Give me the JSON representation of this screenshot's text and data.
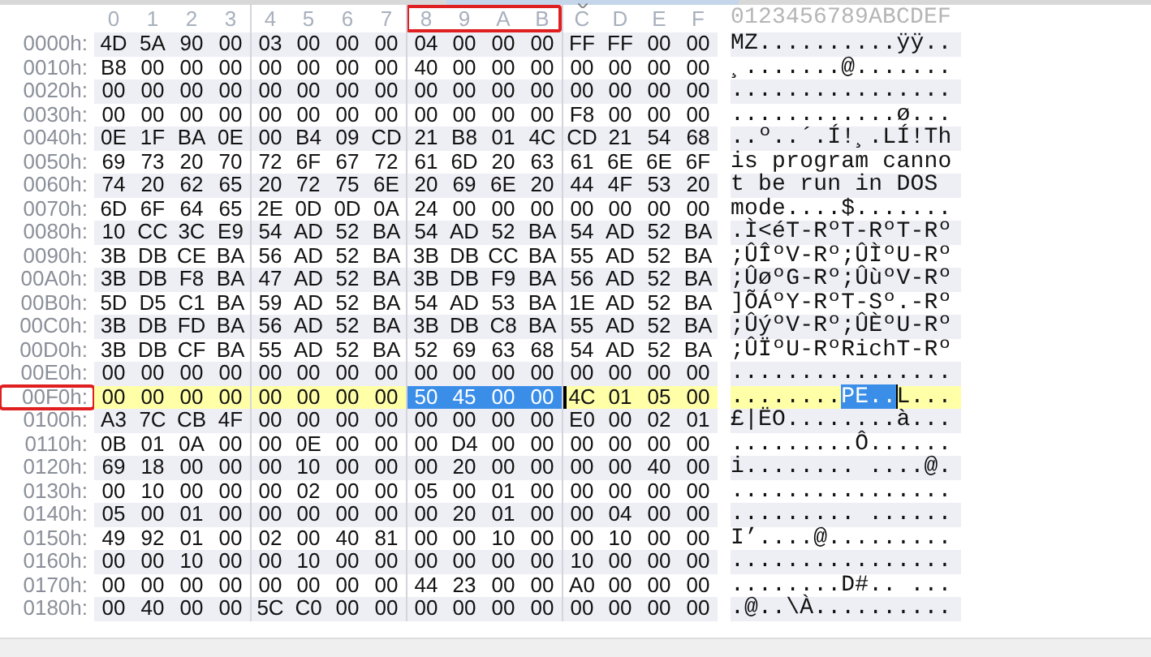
{
  "header": {
    "columns": [
      {
        "label": "0",
        "cursor": false,
        "marked": false
      },
      {
        "label": "1",
        "cursor": false,
        "marked": false
      },
      {
        "label": "2",
        "cursor": false,
        "marked": false
      },
      {
        "label": "3",
        "cursor": false,
        "marked": false
      },
      {
        "label": "4",
        "cursor": false,
        "marked": false
      },
      {
        "label": "5",
        "cursor": false,
        "marked": false
      },
      {
        "label": "6",
        "cursor": false,
        "marked": false
      },
      {
        "label": "7",
        "cursor": false,
        "marked": false
      },
      {
        "label": "8",
        "cursor": false,
        "marked": true
      },
      {
        "label": "9",
        "cursor": false,
        "marked": true
      },
      {
        "label": "A",
        "cursor": false,
        "marked": true
      },
      {
        "label": "B",
        "cursor": false,
        "marked": true
      },
      {
        "label": "C",
        "cursor": true,
        "marked": false
      },
      {
        "label": "D",
        "cursor": false,
        "marked": false
      },
      {
        "label": "E",
        "cursor": false,
        "marked": false
      },
      {
        "label": "F",
        "cursor": false,
        "marked": false
      }
    ],
    "text_header": "0123456789ABCDEF"
  },
  "rows": [
    {
      "offset": "0000h:",
      "bytes": "4D 5A 90 00 03 00 00 00 04 00 00 00 FF FF 00 00",
      "text": "MZ..........ÿÿ..",
      "current": false,
      "marked": false,
      "selected": [
        false,
        false,
        false,
        false,
        false,
        false,
        false,
        false,
        false,
        false,
        false,
        false,
        false,
        false,
        false,
        false
      ]
    },
    {
      "offset": "0010h:",
      "bytes": "B8 00 00 00 00 00 00 00 40 00 00 00 00 00 00 00",
      "text": "¸.......@.......",
      "current": false,
      "marked": false,
      "selected": [
        false,
        false,
        false,
        false,
        false,
        false,
        false,
        false,
        false,
        false,
        false,
        false,
        false,
        false,
        false,
        false
      ]
    },
    {
      "offset": "0020h:",
      "bytes": "00 00 00 00 00 00 00 00 00 00 00 00 00 00 00 00",
      "text": "................",
      "current": false,
      "marked": false,
      "selected": [
        false,
        false,
        false,
        false,
        false,
        false,
        false,
        false,
        false,
        false,
        false,
        false,
        false,
        false,
        false,
        false
      ]
    },
    {
      "offset": "0030h:",
      "bytes": "00 00 00 00 00 00 00 00 00 00 00 00 F8 00 00 00",
      "text": "............ø...",
      "current": false,
      "marked": false,
      "selected": [
        false,
        false,
        false,
        false,
        false,
        false,
        false,
        false,
        false,
        false,
        false,
        false,
        false,
        false,
        false,
        false
      ]
    },
    {
      "offset": "0040h:",
      "bytes": "0E 1F BA 0E 00 B4 09 CD 21 B8 01 4C CD 21 54 68",
      "text": "..º..´.Í!¸.LÍ!Th",
      "current": false,
      "marked": false,
      "selected": [
        false,
        false,
        false,
        false,
        false,
        false,
        false,
        false,
        false,
        false,
        false,
        false,
        false,
        false,
        false,
        false
      ]
    },
    {
      "offset": "0050h:",
      "bytes": "69 73 20 70 72 6F 67 72 61 6D 20 63 61 6E 6E 6F",
      "text": "is program canno",
      "current": false,
      "marked": false,
      "selected": [
        false,
        false,
        false,
        false,
        false,
        false,
        false,
        false,
        false,
        false,
        false,
        false,
        false,
        false,
        false,
        false
      ]
    },
    {
      "offset": "0060h:",
      "bytes": "74 20 62 65 20 72 75 6E 20 69 6E 20 44 4F 53 20",
      "text": "t be run in DOS ",
      "current": false,
      "marked": false,
      "selected": [
        false,
        false,
        false,
        false,
        false,
        false,
        false,
        false,
        false,
        false,
        false,
        false,
        false,
        false,
        false,
        false
      ]
    },
    {
      "offset": "0070h:",
      "bytes": "6D 6F 64 65 2E 0D 0D 0A 24 00 00 00 00 00 00 00",
      "text": "mode....$.......",
      "current": false,
      "marked": false,
      "selected": [
        false,
        false,
        false,
        false,
        false,
        false,
        false,
        false,
        false,
        false,
        false,
        false,
        false,
        false,
        false,
        false
      ]
    },
    {
      "offset": "0080h:",
      "bytes": "10 CC 3C E9 54 AD 52 BA 54 AD 52 BA 54 AD 52 BA",
      "text": ".Ì<éT-RºT-RºT-Rº",
      "current": false,
      "marked": false,
      "selected": [
        false,
        false,
        false,
        false,
        false,
        false,
        false,
        false,
        false,
        false,
        false,
        false,
        false,
        false,
        false,
        false
      ]
    },
    {
      "offset": "0090h:",
      "bytes": "3B DB CE BA 56 AD 52 BA 3B DB CC BA 55 AD 52 BA",
      "text": ";ÛÎºV-Rº;ÛÌºU-Rº",
      "current": false,
      "marked": false,
      "selected": [
        false,
        false,
        false,
        false,
        false,
        false,
        false,
        false,
        false,
        false,
        false,
        false,
        false,
        false,
        false,
        false
      ]
    },
    {
      "offset": "00A0h:",
      "bytes": "3B DB F8 BA 47 AD 52 BA 3B DB F9 BA 56 AD 52 BA",
      "text": ";ÛøºG-Rº;ÛùºV-Rº",
      "current": false,
      "marked": false,
      "selected": [
        false,
        false,
        false,
        false,
        false,
        false,
        false,
        false,
        false,
        false,
        false,
        false,
        false,
        false,
        false,
        false
      ]
    },
    {
      "offset": "00B0h:",
      "bytes": "5D D5 C1 BA 59 AD 52 BA 54 AD 53 BA 1E AD 52 BA",
      "text": "]ÕÁºY-RºT-Sº.-Rº",
      "current": false,
      "marked": false,
      "selected": [
        false,
        false,
        false,
        false,
        false,
        false,
        false,
        false,
        false,
        false,
        false,
        false,
        false,
        false,
        false,
        false
      ]
    },
    {
      "offset": "00C0h:",
      "bytes": "3B DB FD BA 56 AD 52 BA 3B DB C8 BA 55 AD 52 BA",
      "text": ";ÛýºV-Rº;ÛÈºU-Rº",
      "current": false,
      "marked": false,
      "selected": [
        false,
        false,
        false,
        false,
        false,
        false,
        false,
        false,
        false,
        false,
        false,
        false,
        false,
        false,
        false,
        false
      ]
    },
    {
      "offset": "00D0h:",
      "bytes": "3B DB CF BA 55 AD 52 BA 52 69 63 68 54 AD 52 BA",
      "text": ";ÛÏºU-RºRichT-Rº",
      "current": false,
      "marked": false,
      "selected": [
        false,
        false,
        false,
        false,
        false,
        false,
        false,
        false,
        false,
        false,
        false,
        false,
        false,
        false,
        false,
        false
      ]
    },
    {
      "offset": "00E0h:",
      "bytes": "00 00 00 00 00 00 00 00 00 00 00 00 00 00 00 00",
      "text": "................",
      "current": false,
      "marked": false,
      "selected": [
        false,
        false,
        false,
        false,
        false,
        false,
        false,
        false,
        false,
        false,
        false,
        false,
        false,
        false,
        false,
        false
      ]
    },
    {
      "offset": "00F0h:",
      "bytes": "00 00 00 00 00 00 00 00 50 45 00 00 4C 01 05 00",
      "text": "........PE..L...",
      "current": true,
      "marked": true,
      "selected": [
        false,
        false,
        false,
        false,
        false,
        false,
        false,
        false,
        true,
        true,
        true,
        true,
        false,
        false,
        false,
        false
      ]
    },
    {
      "offset": "0100h:",
      "bytes": "A3 7C CB 4F 00 00 00 00 00 00 00 00 E0 00 02 01",
      "text": "£|ËO........à...",
      "current": false,
      "marked": false,
      "selected": [
        false,
        false,
        false,
        false,
        false,
        false,
        false,
        false,
        false,
        false,
        false,
        false,
        false,
        false,
        false,
        false
      ]
    },
    {
      "offset": "0110h:",
      "bytes": "0B 01 0A 00 00 0E 00 00 00 D4 00 00 00 00 00 00",
      "text": ".........Ô......",
      "current": false,
      "marked": false,
      "selected": [
        false,
        false,
        false,
        false,
        false,
        false,
        false,
        false,
        false,
        false,
        false,
        false,
        false,
        false,
        false,
        false
      ]
    },
    {
      "offset": "0120h:",
      "bytes": "69 18 00 00 00 10 00 00 00 20 00 00 00 00 40 00",
      "text": "i........ ....@.",
      "current": false,
      "marked": false,
      "selected": [
        false,
        false,
        false,
        false,
        false,
        false,
        false,
        false,
        false,
        false,
        false,
        false,
        false,
        false,
        false,
        false
      ]
    },
    {
      "offset": "0130h:",
      "bytes": "00 10 00 00 00 02 00 00 05 00 01 00 00 00 00 00",
      "text": "................",
      "current": false,
      "marked": false,
      "selected": [
        false,
        false,
        false,
        false,
        false,
        false,
        false,
        false,
        false,
        false,
        false,
        false,
        false,
        false,
        false,
        false
      ]
    },
    {
      "offset": "0140h:",
      "bytes": "05 00 01 00 00 00 00 00 00 20 01 00 00 04 00 00",
      "text": "......... ......",
      "current": false,
      "marked": false,
      "selected": [
        false,
        false,
        false,
        false,
        false,
        false,
        false,
        false,
        false,
        false,
        false,
        false,
        false,
        false,
        false,
        false
      ]
    },
    {
      "offset": "0150h:",
      "bytes": "49 92 01 00 02 00 40 81 00 00 10 00 00 10 00 00",
      "text": "I’....@.........",
      "current": false,
      "marked": false,
      "selected": [
        false,
        false,
        false,
        false,
        false,
        false,
        false,
        false,
        false,
        false,
        false,
        false,
        false,
        false,
        false,
        false
      ]
    },
    {
      "offset": "0160h:",
      "bytes": "00 00 10 00 00 10 00 00 00 00 00 00 10 00 00 00",
      "text": "................",
      "current": false,
      "marked": false,
      "selected": [
        false,
        false,
        false,
        false,
        false,
        false,
        false,
        false,
        false,
        false,
        false,
        false,
        false,
        false,
        false,
        false
      ]
    },
    {
      "offset": "0170h:",
      "bytes": "00 00 00 00 00 00 00 00 44 23 00 00 A0 00 00 00",
      "text": "........D#.. ...",
      "current": false,
      "marked": false,
      "selected": [
        false,
        false,
        false,
        false,
        false,
        false,
        false,
        false,
        false,
        false,
        false,
        false,
        false,
        false,
        false,
        false
      ]
    },
    {
      "offset": "0180h:",
      "bytes": "00 40 00 00 5C C0 00 00 00 00 00 00 00 00 00 00",
      "text": ".@..\\À..........",
      "current": false,
      "marked": false,
      "selected": [
        false,
        false,
        false,
        false,
        false,
        false,
        false,
        false,
        false,
        false,
        false,
        false,
        false,
        false,
        false,
        false
      ]
    }
  ]
}
